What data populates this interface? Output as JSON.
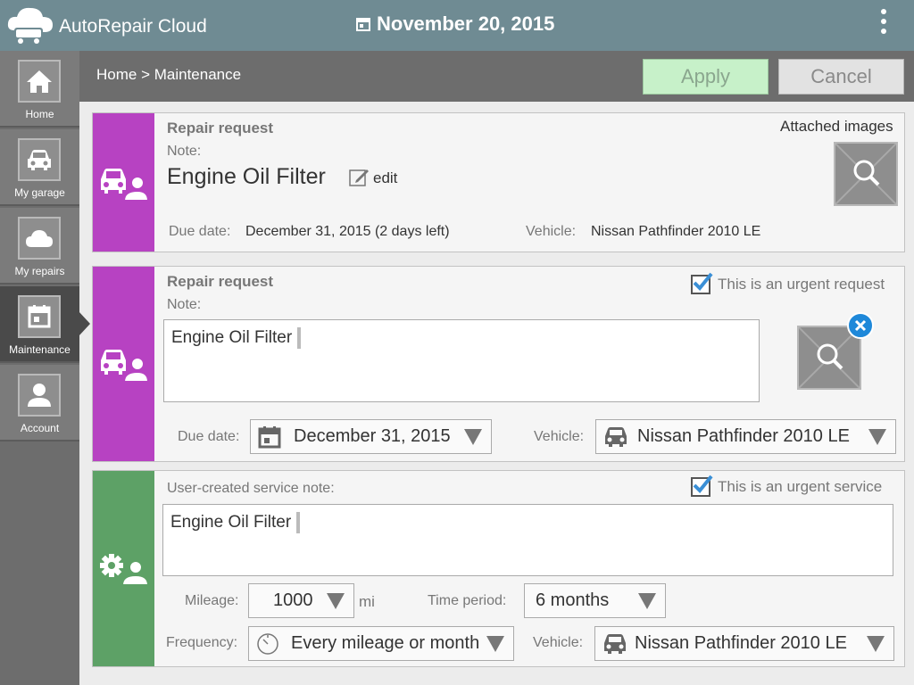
{
  "app": {
    "title": "AutoRepair Cloud",
    "date": "November 20, 2015"
  },
  "colors": {
    "topbar": "#6f8b93",
    "repair_accent": "#b742c2",
    "service_accent": "#5da166",
    "apply_bg": "#c7f1c9",
    "remove_badge": "#1e88d9",
    "check": "#3a8fd6"
  },
  "sidebar": {
    "items": [
      {
        "label": "Home",
        "icon": "home-icon"
      },
      {
        "label": "My garage",
        "icon": "car-icon"
      },
      {
        "label": "My repairs",
        "icon": "cloud-icon"
      },
      {
        "label": "Maintenance",
        "icon": "calendar-icon"
      },
      {
        "label": "Account",
        "icon": "person-icon"
      }
    ]
  },
  "header": {
    "breadcrumb": "Home > Maintenance",
    "apply_label": "Apply",
    "cancel_label": "Cancel"
  },
  "card1": {
    "title": "Repair request",
    "note_label": "Note:",
    "note": "Engine Oil Filter",
    "edit_label": "edit",
    "attached_label": "Attached images",
    "due_label": "Due date:",
    "due_value": "December 31, 2015 (2 days left)",
    "vehicle_label": "Vehicle:",
    "vehicle_value": "Nissan Pathfinder 2010 LE"
  },
  "card2": {
    "title": "Repair request",
    "urgent_label": "This is an urgent request",
    "urgent_checked": true,
    "note_label": "Note:",
    "note": "Engine Oil Filter",
    "due_label": "Due date:",
    "due_value": "December 31, 2015",
    "vehicle_label": "Vehicle:",
    "vehicle_value": "Nissan Pathfinder 2010 LE"
  },
  "card3": {
    "title": "User-created service note:",
    "urgent_label": "This is an urgent service",
    "urgent_checked": true,
    "note": "Engine Oil Filter",
    "mileage_label": "Mileage:",
    "mileage_value": "1000",
    "mileage_unit": "mi",
    "period_label": "Time period:",
    "period_value": "6 months",
    "frequency_label": "Frequency:",
    "frequency_value": "Every mileage or month",
    "vehicle_label": "Vehicle:",
    "vehicle_value": "Nissan Pathfinder 2010 LE"
  }
}
